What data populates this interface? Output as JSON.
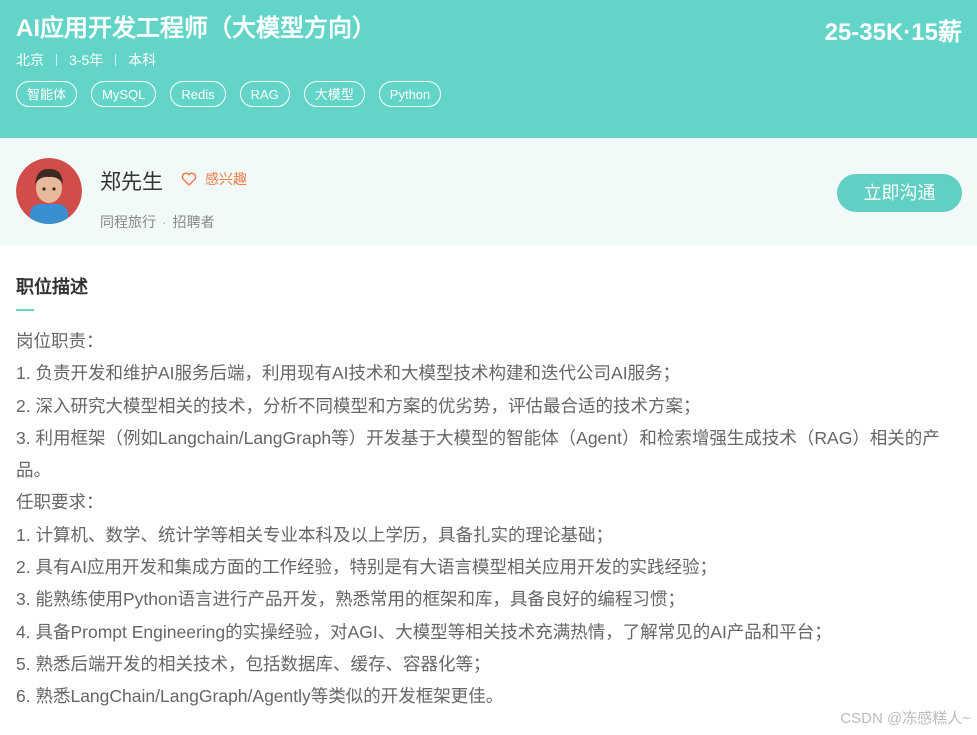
{
  "job": {
    "title": "AI应用开发工程师（大模型方向）",
    "salary": "25-35K·15薪",
    "city": "北京",
    "experience": "3-5年",
    "education": "本科",
    "tags": [
      "智能体",
      "MySQL",
      "Redis",
      "RAG",
      "大模型",
      "Python"
    ]
  },
  "recruiter": {
    "name": "郑先生",
    "interest_label": "感兴趣",
    "company": "同程旅行",
    "role": "招聘者",
    "chat_button": "立即沟通"
  },
  "description": {
    "section_title": "职位描述",
    "lines": [
      "岗位职责：",
      "1. 负责开发和维护AI服务后端，利用现有AI技术和大模型技术构建和迭代公司AI服务；",
      "2. 深入研究大模型相关的技术，分析不同模型和方案的优劣势，评估最合适的技术方案；",
      "3. 利用框架（例如Langchain/LangGraph等）开发基于大模型的智能体（Agent）和检索增强生成技术（RAG）相关的产品。",
      "任职要求：",
      "1. 计算机、数学、统计学等相关专业本科及以上学历，具备扎实的理论基础；",
      "2. 具有AI应用开发和集成方面的工作经验，特别是有大语言模型相关应用开发的实践经验；",
      "3. 能熟练使用Python语言进行产品开发，熟悉常用的框架和库，具备良好的编程习惯；",
      "4. 具备Prompt Engineering的实操经验，对AGI、大模型等相关技术充满热情，了解常见的AI产品和平台；",
      "5. 熟悉后端开发的相关技术，包括数据库、缓存、容器化等；",
      "6. 熟悉LangChain/LangGraph/Agently等类似的开发框架更佳。"
    ]
  },
  "watermark": "CSDN @冻感糕人~",
  "colors": {
    "header_bg": "#62d5c8",
    "accent": "#5fd0c3",
    "interest": "#ef7c49"
  }
}
